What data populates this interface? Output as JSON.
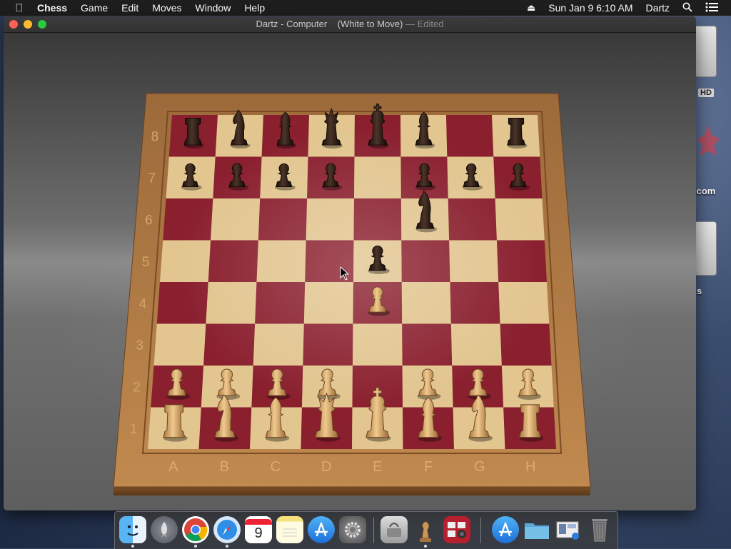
{
  "menubar": {
    "app_name": "Chess",
    "items": [
      "Game",
      "Edit",
      "Moves",
      "Window",
      "Help"
    ],
    "clock": "Sun Jan 9  6:10 AM",
    "user": "Dartz"
  },
  "desktop": {
    "icons": [
      {
        "label": "HD"
      },
      {
        "label": ".com"
      },
      {
        "label": "s"
      }
    ]
  },
  "window": {
    "title": "Dartz - Computer",
    "subtitle": "(White to Move)",
    "edited": "— Edited"
  },
  "board": {
    "files": [
      "A",
      "B",
      "C",
      "D",
      "E",
      "F",
      "G",
      "H"
    ],
    "ranks": [
      "1",
      "2",
      "3",
      "4",
      "5",
      "6",
      "7",
      "8"
    ],
    "pieces": [
      {
        "color": "black",
        "type": "rook",
        "square": "a8"
      },
      {
        "color": "black",
        "type": "knight",
        "square": "b8"
      },
      {
        "color": "black",
        "type": "bishop",
        "square": "c8"
      },
      {
        "color": "black",
        "type": "queen",
        "square": "d8"
      },
      {
        "color": "black",
        "type": "king",
        "square": "e8"
      },
      {
        "color": "black",
        "type": "bishop",
        "square": "f8"
      },
      {
        "color": "black",
        "type": "rook",
        "square": "h8"
      },
      {
        "color": "black",
        "type": "pawn",
        "square": "a7"
      },
      {
        "color": "black",
        "type": "pawn",
        "square": "b7"
      },
      {
        "color": "black",
        "type": "pawn",
        "square": "c7"
      },
      {
        "color": "black",
        "type": "pawn",
        "square": "d7"
      },
      {
        "color": "black",
        "type": "pawn",
        "square": "f7"
      },
      {
        "color": "black",
        "type": "pawn",
        "square": "g7"
      },
      {
        "color": "black",
        "type": "pawn",
        "square": "h7"
      },
      {
        "color": "black",
        "type": "knight",
        "square": "f6"
      },
      {
        "color": "black",
        "type": "pawn",
        "square": "e5"
      },
      {
        "color": "white",
        "type": "pawn",
        "square": "e4"
      },
      {
        "color": "white",
        "type": "pawn",
        "square": "a2"
      },
      {
        "color": "white",
        "type": "pawn",
        "square": "b2"
      },
      {
        "color": "white",
        "type": "pawn",
        "square": "c2"
      },
      {
        "color": "white",
        "type": "pawn",
        "square": "d2"
      },
      {
        "color": "white",
        "type": "pawn",
        "square": "f2"
      },
      {
        "color": "white",
        "type": "pawn",
        "square": "g2"
      },
      {
        "color": "white",
        "type": "pawn",
        "square": "h2"
      },
      {
        "color": "white",
        "type": "rook",
        "square": "a1"
      },
      {
        "color": "white",
        "type": "knight",
        "square": "b1"
      },
      {
        "color": "white",
        "type": "bishop",
        "square": "c1"
      },
      {
        "color": "white",
        "type": "queen",
        "square": "d1"
      },
      {
        "color": "white",
        "type": "king",
        "square": "e1"
      },
      {
        "color": "white",
        "type": "bishop",
        "square": "f1"
      },
      {
        "color": "white",
        "type": "knight",
        "square": "g1"
      },
      {
        "color": "white",
        "type": "rook",
        "square": "h1"
      }
    ],
    "colors": {
      "light_square": "#e2c58f",
      "dark_square": "#8a1f2e",
      "frame": "#b07a45",
      "black_piece": "#2a1a12",
      "white_piece": "#d7a766"
    }
  },
  "dock": {
    "items": [
      {
        "name": "finder-icon",
        "running": true
      },
      {
        "name": "launchpad-icon",
        "running": false
      },
      {
        "name": "chrome-icon",
        "running": true
      },
      {
        "name": "safari-icon",
        "running": true
      },
      {
        "name": "calendar-icon",
        "label": "9",
        "running": false
      },
      {
        "name": "notes-icon",
        "running": false
      },
      {
        "name": "app-store-icon",
        "running": false
      },
      {
        "name": "system-preferences-icon",
        "running": false
      },
      {
        "name": "disk-utility-icon",
        "running": false
      },
      {
        "name": "chess-app-icon",
        "running": true
      },
      {
        "name": "photo-booth-icon",
        "running": false
      },
      {
        "name": "app-store-folder-icon",
        "running": false
      },
      {
        "name": "folder-icon",
        "running": false
      },
      {
        "name": "preview-icon",
        "running": false
      },
      {
        "name": "trash-icon",
        "running": false
      }
    ]
  }
}
